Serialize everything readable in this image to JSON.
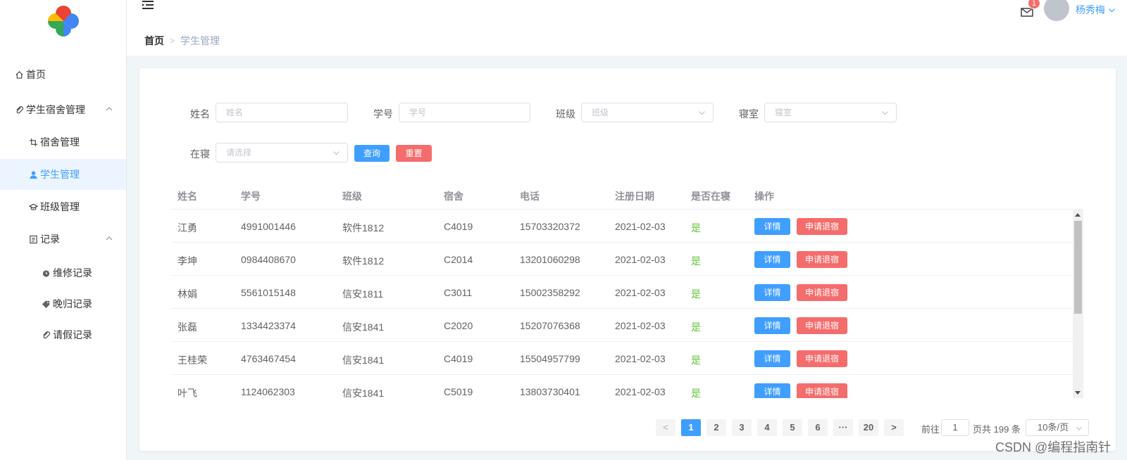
{
  "colors": {
    "primary": "#409eff",
    "danger": "#f56c6c",
    "success": "#67c23a"
  },
  "sidebar": {
    "items": [
      {
        "label": "首页",
        "icon": "home-icon"
      },
      {
        "label": "学生宿舍管理",
        "icon": "paperclip-icon"
      },
      {
        "label": "宿舍管理",
        "icon": "crop-icon"
      },
      {
        "label": "学生管理",
        "icon": "user-icon"
      },
      {
        "label": "班级管理",
        "icon": "graduation-icon"
      },
      {
        "label": "记录",
        "icon": "document-icon"
      },
      {
        "label": "维修记录",
        "icon": "alarm-icon"
      },
      {
        "label": "晚归记录",
        "icon": "tag-icon"
      },
      {
        "label": "请假记录",
        "icon": "paperclip-icon"
      }
    ]
  },
  "header": {
    "breadcrumb_home": "首页",
    "breadcrumb_current": "学生管理",
    "badge_count": "1",
    "username": "杨秀梅"
  },
  "filters": {
    "name_label": "姓名",
    "name_placeholder": "姓名",
    "id_label": "学号",
    "id_placeholder": "学号",
    "class_label": "班级",
    "class_placeholder": "班级",
    "room_label": "寝室",
    "room_placeholder": "寝室",
    "present_label": "在寝",
    "present_placeholder": "请选择",
    "query_button": "查询",
    "reset_button": "重置"
  },
  "table": {
    "headers": [
      "姓名",
      "学号",
      "班级",
      "宿舍",
      "电话",
      "注册日期",
      "是否在寝",
      "操作"
    ],
    "detail_label": "详情",
    "checkout_label": "申请退宿",
    "rows": [
      {
        "name": "江勇",
        "id": "4991001446",
        "class": "软件1812",
        "room": "C4019",
        "phone": "15703320372",
        "date": "2021-02-03",
        "present": "是"
      },
      {
        "name": "李坤",
        "id": "0984408670",
        "class": "软件1812",
        "room": "C2014",
        "phone": "13201060298",
        "date": "2021-02-03",
        "present": "是"
      },
      {
        "name": "林娟",
        "id": "5561015148",
        "class": "信安1811",
        "room": "C3011",
        "phone": "15002358292",
        "date": "2021-02-03",
        "present": "是"
      },
      {
        "name": "张磊",
        "id": "1334423374",
        "class": "信安1841",
        "room": "C2020",
        "phone": "15207076368",
        "date": "2021-02-03",
        "present": "是"
      },
      {
        "name": "王桂荣",
        "id": "4763467454",
        "class": "信安1841",
        "room": "C4019",
        "phone": "15504957799",
        "date": "2021-02-03",
        "present": "是"
      },
      {
        "name": "叶飞",
        "id": "1124062303",
        "class": "信安1841",
        "room": "C5019",
        "phone": "13803730401",
        "date": "2021-02-03",
        "present": "是"
      }
    ]
  },
  "pagination": {
    "prev": "<",
    "next": ">",
    "pages": [
      "1",
      "2",
      "3",
      "4",
      "5",
      "6",
      "···",
      "20"
    ],
    "current": "1",
    "goto_prefix": "前往",
    "goto_value": "1",
    "goto_suffix": "页共 199 条",
    "page_size": "10条/页"
  },
  "watermark": "CSDN @编程指南针"
}
